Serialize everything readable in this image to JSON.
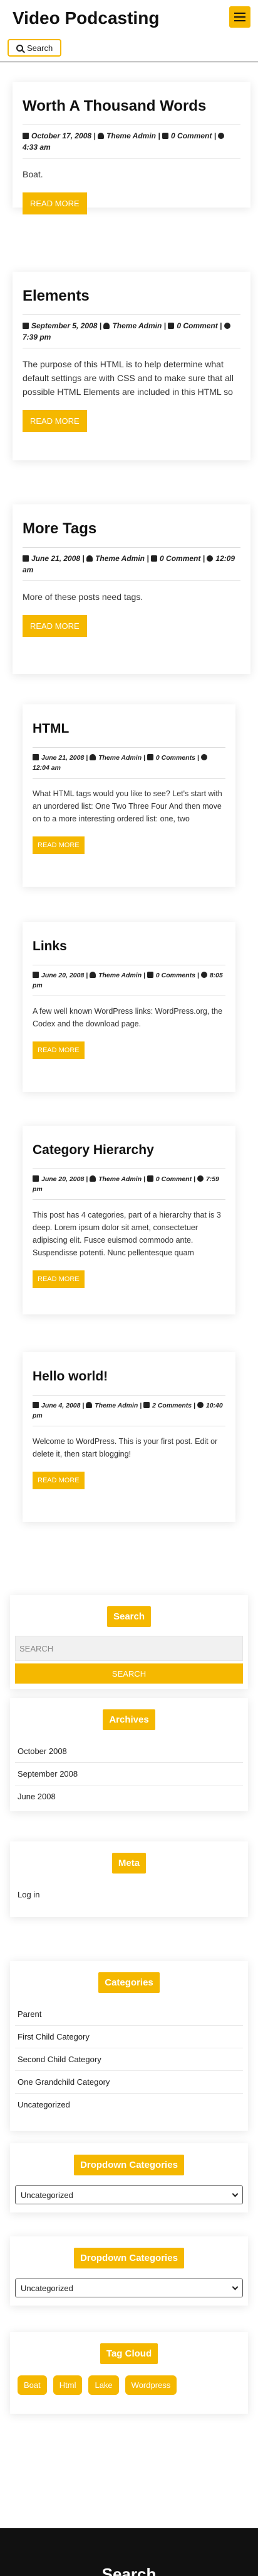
{
  "header": {
    "site_title": "Video Podcasting",
    "search_label": "Search"
  },
  "posts": [
    {
      "title": "Worth A Thousand Words",
      "date": "October 17, 2008",
      "author": "Theme Admin",
      "comments": "0 Comment",
      "time": "4:33 am",
      "excerpt": "Boat.",
      "read_more": "READ MORE"
    },
    {
      "title": "Elements",
      "date": "September 5, 2008",
      "author": "Theme Admin",
      "comments": "0 Comment",
      "time": "7:39 pm",
      "excerpt": "The purpose of this HTML is to help determine what default settings are with CSS and to make sure that all possible HTML Elements are included in this HTML so",
      "read_more": "READ MORE"
    },
    {
      "title": "More Tags",
      "date": "June 21, 2008",
      "author": "Theme Admin",
      "comments": "0 Comment",
      "time": "12:09 am",
      "excerpt": "More of these posts need tags.",
      "read_more": "READ MORE"
    },
    {
      "title": "HTML",
      "date": "June 21, 2008",
      "author": "Theme Admin",
      "comments": "0 Comments",
      "time": "12:04 am",
      "excerpt": "What HTML tags would you like to see? Let's start with an unordered list: One Two Three Four And then move on to a more interesting ordered list: one, two",
      "read_more": "READ MORE"
    },
    {
      "title": "Links",
      "date": "June 20, 2008",
      "author": "Theme Admin",
      "comments": "0 Comments",
      "time": "8:05 pm",
      "excerpt": "A few well known WordPress links: WordPress.org, the Codex and the download page.",
      "read_more": "READ MORE"
    },
    {
      "title": "Category Hierarchy",
      "date": "June 20, 2008",
      "author": "Theme Admin",
      "comments": "0 Comment",
      "time": "7:59 pm",
      "excerpt": "This post has 4 categories, part of a hierarchy that is 3 deep. Lorem ipsum dolor sit amet, consectetuer adipiscing elit. Fusce euismod commodo ante. Suspendisse potenti. Nunc pellentesque quam",
      "read_more": "READ MORE"
    },
    {
      "title": "Hello world!",
      "date": "June 4, 2008",
      "author": "Theme Admin",
      "comments": "2 Comments",
      "time": "10:40 pm",
      "excerpt": "Welcome to WordPress. This is your first post. Edit or delete it, then start blogging!",
      "read_more": "READ MORE"
    }
  ],
  "widgets": {
    "search": {
      "title": "Search",
      "placeholder": "SEARCH",
      "button": "SEARCH"
    },
    "archives": {
      "title": "Archives",
      "items": [
        "October 2008",
        "September 2008",
        "June 2008"
      ]
    },
    "meta": {
      "title": "Meta",
      "items": [
        "Log in"
      ]
    },
    "categories": {
      "title": "Categories",
      "items": [
        "Parent",
        "First Child Category",
        "Second Child Category",
        "One Grandchild Category",
        "Uncategorized"
      ]
    },
    "dropdown1": {
      "title": "Dropdown Categories",
      "selected": "Uncategorized"
    },
    "dropdown2": {
      "title": "Dropdown Categories",
      "selected": "Uncategorized"
    },
    "tags": {
      "title": "Tag Cloud",
      "items": [
        "Boat",
        "Html",
        "Lake",
        "Wordpress"
      ]
    }
  },
  "footer": {
    "title": "Search"
  },
  "colors": {
    "accent": "#f5b800",
    "footer_bg": "#111111"
  }
}
